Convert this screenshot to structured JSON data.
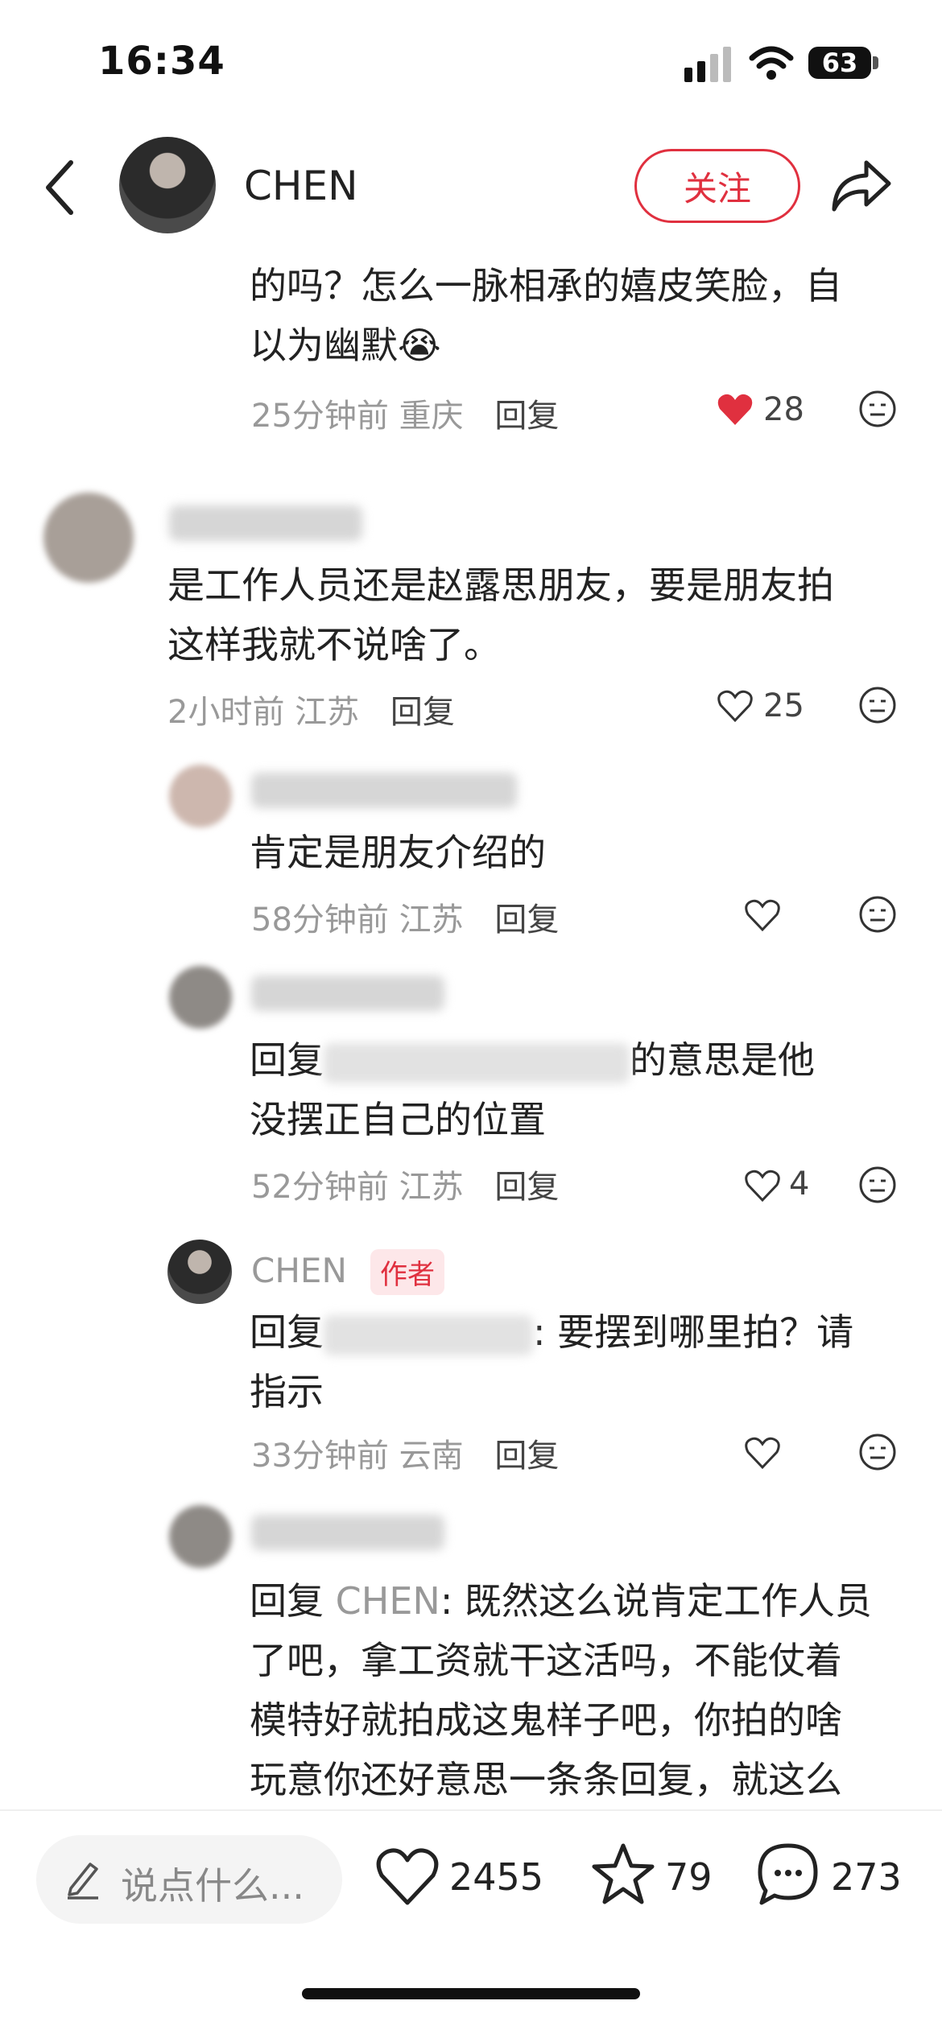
{
  "status_bar": {
    "time": "16:34",
    "battery": "63"
  },
  "header": {
    "name": "CHEN",
    "follow_label": "关注"
  },
  "comments": [
    {
      "text_line1": "的吗？怎么一脉相承的嬉皮笑脸，自",
      "text_line2": "以为幽默",
      "emoji": "😭",
      "meta": "25分钟前 重庆",
      "reply_label": "回复",
      "likes": "28"
    },
    {
      "text_line1": "是工作人员还是赵露思朋友，要是朋友拍",
      "text_line2": "这样我就不说啥了。",
      "meta": "2小时前 江苏",
      "reply_label": "回复",
      "likes": "25"
    },
    {
      "text": "肯定是朋友介绍的",
      "meta": "58分钟前 江苏",
      "reply_label": "回复"
    },
    {
      "text_prefix": "回复",
      "text_suffix": "的意思是他",
      "text_line2": "没摆正自己的位置",
      "meta": "52分钟前 江苏",
      "reply_label": "回复",
      "likes": "4"
    },
    {
      "author": "CHEN",
      "author_tag": "作者",
      "text_prefix": "回复",
      "text_suffix": ": 要摆到哪里拍？请",
      "text_line2": "指示",
      "meta": "33分钟前 云南",
      "reply_label": "回复"
    },
    {
      "reply_prefix": "回复 ",
      "reply_to": "CHEN",
      "reply_rest": ": 既然这么说肯定工作人员",
      "line2": "了吧，拿工资就干这活吗，不能仗着",
      "line3": "模特好就拍成这鬼样子吧，你拍的啥",
      "line4": "玩意你还好意思一条条回复，就这么"
    }
  ],
  "bottom_bar": {
    "placeholder": "说点什么...",
    "likes": "2455",
    "stars": "79",
    "comments": "273"
  },
  "colors": {
    "accent": "#e0303f",
    "muted": "#999999"
  },
  "icons": [
    "back-arrow-icon",
    "share-icon",
    "heart-icon",
    "emoji-face-icon",
    "star-icon",
    "comment-bubble-icon",
    "pencil-icon"
  ]
}
